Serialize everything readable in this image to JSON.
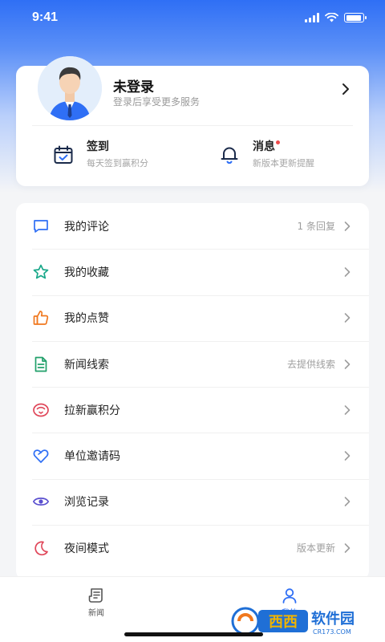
{
  "status_bar": {
    "time": "9:41",
    "battery_level": 0.9
  },
  "profile": {
    "name": "未登录",
    "subtitle": "登录后享受更多服务",
    "arrow_icon": "chevron-right-icon",
    "avatar_icon": "user-avatar"
  },
  "quick_actions": [
    {
      "title": "签到",
      "subtitle": "每天签到赢积分",
      "icon": "calendar-check-icon"
    },
    {
      "title": "消息",
      "subtitle": "新版本更新提醒",
      "icon": "bell-icon",
      "badge_color": "#ef4b4b"
    }
  ],
  "menu": [
    {
      "label": "我的评论",
      "extra": "1 条回复",
      "icon": "comment-icon",
      "color": "#2f6ff5"
    },
    {
      "label": "我的收藏",
      "extra": "",
      "icon": "star-icon",
      "color": "#1aa88a"
    },
    {
      "label": "我的点赞",
      "extra": "",
      "icon": "thumbs-up-icon",
      "color": "#f0781e"
    },
    {
      "label": "新闻线索",
      "extra": "去提供线索",
      "icon": "document-icon",
      "color": "#22a06b"
    },
    {
      "label": "拉新赢积分",
      "extra": "",
      "icon": "wifi-badge-icon",
      "color": "#e0475a"
    },
    {
      "label": "单位邀请码",
      "extra": "",
      "icon": "heart-icon",
      "color": "#2f6ff5"
    },
    {
      "label": "浏览记录",
      "extra": "",
      "icon": "eye-icon",
      "color": "#5a4fcf"
    },
    {
      "label": "夜间模式",
      "extra": "版本更新",
      "icon": "moon-icon",
      "color": "#e0475a"
    }
  ],
  "tabs": [
    {
      "label": "新闻",
      "icon": "news-icon",
      "active": false
    },
    {
      "label": "我的",
      "icon": "user-icon",
      "active": true
    }
  ],
  "colors": {
    "accent": "#2f6ff5",
    "text_muted": "#9e9e9e"
  },
  "watermark": {
    "text": "西西软件园",
    "sub": "CR173.COM"
  }
}
